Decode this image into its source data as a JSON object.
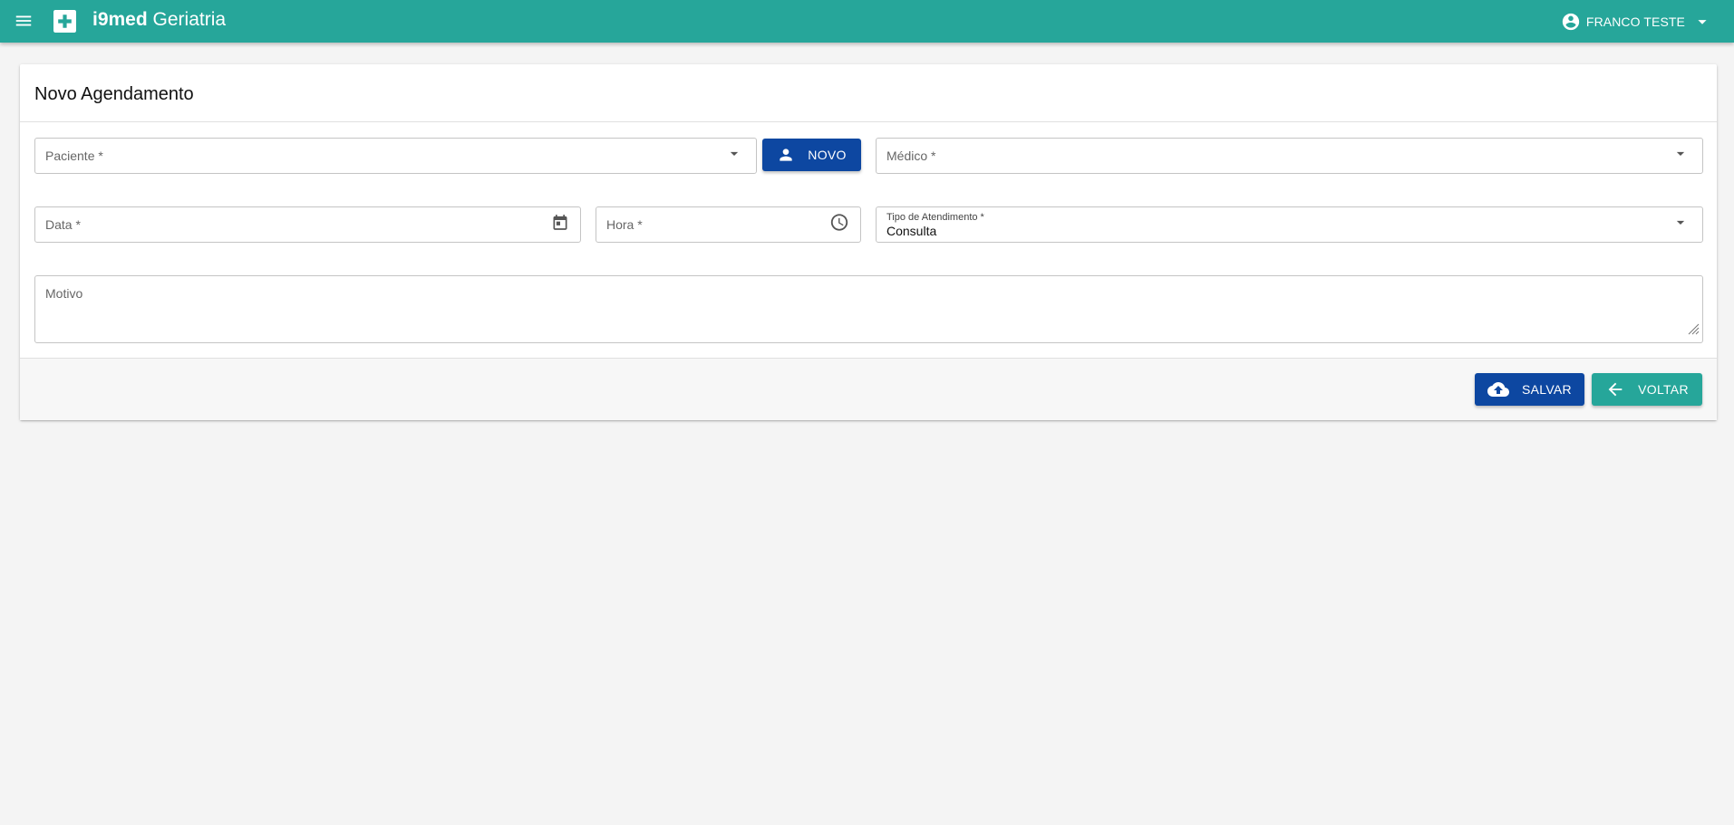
{
  "app": {
    "brand_bold": "i9med",
    "brand_light": "Geriatria",
    "user_name": "FRANCO TESTE",
    "colors": {
      "primary": "#26a69a",
      "accent_blue": "#0d47a1"
    },
    "icons": {
      "menu": "menu-icon",
      "logo": "medical-cross-icon",
      "user": "account-circle-icon",
      "dropdown": "arrow-drop-down-icon"
    }
  },
  "form": {
    "title": "Novo Agendamento",
    "paciente": {
      "label": "Paciente *",
      "value": ""
    },
    "novo_button": {
      "label": "NOVO",
      "icon": "person-icon"
    },
    "medico": {
      "label": "Médico *",
      "value": ""
    },
    "data": {
      "label": "Data *",
      "value": "",
      "icon": "calendar-icon"
    },
    "hora": {
      "label": "Hora *",
      "value": "",
      "icon": "clock-icon"
    },
    "tipo_atendimento": {
      "label": "Tipo de Atendimento *",
      "value": "Consulta"
    },
    "motivo": {
      "label": "Motivo",
      "value": ""
    }
  },
  "footer": {
    "save_label": "SALVAR",
    "save_icon": "cloud-upload-icon",
    "back_label": "VOLTAR",
    "back_icon": "arrow-back-icon"
  }
}
